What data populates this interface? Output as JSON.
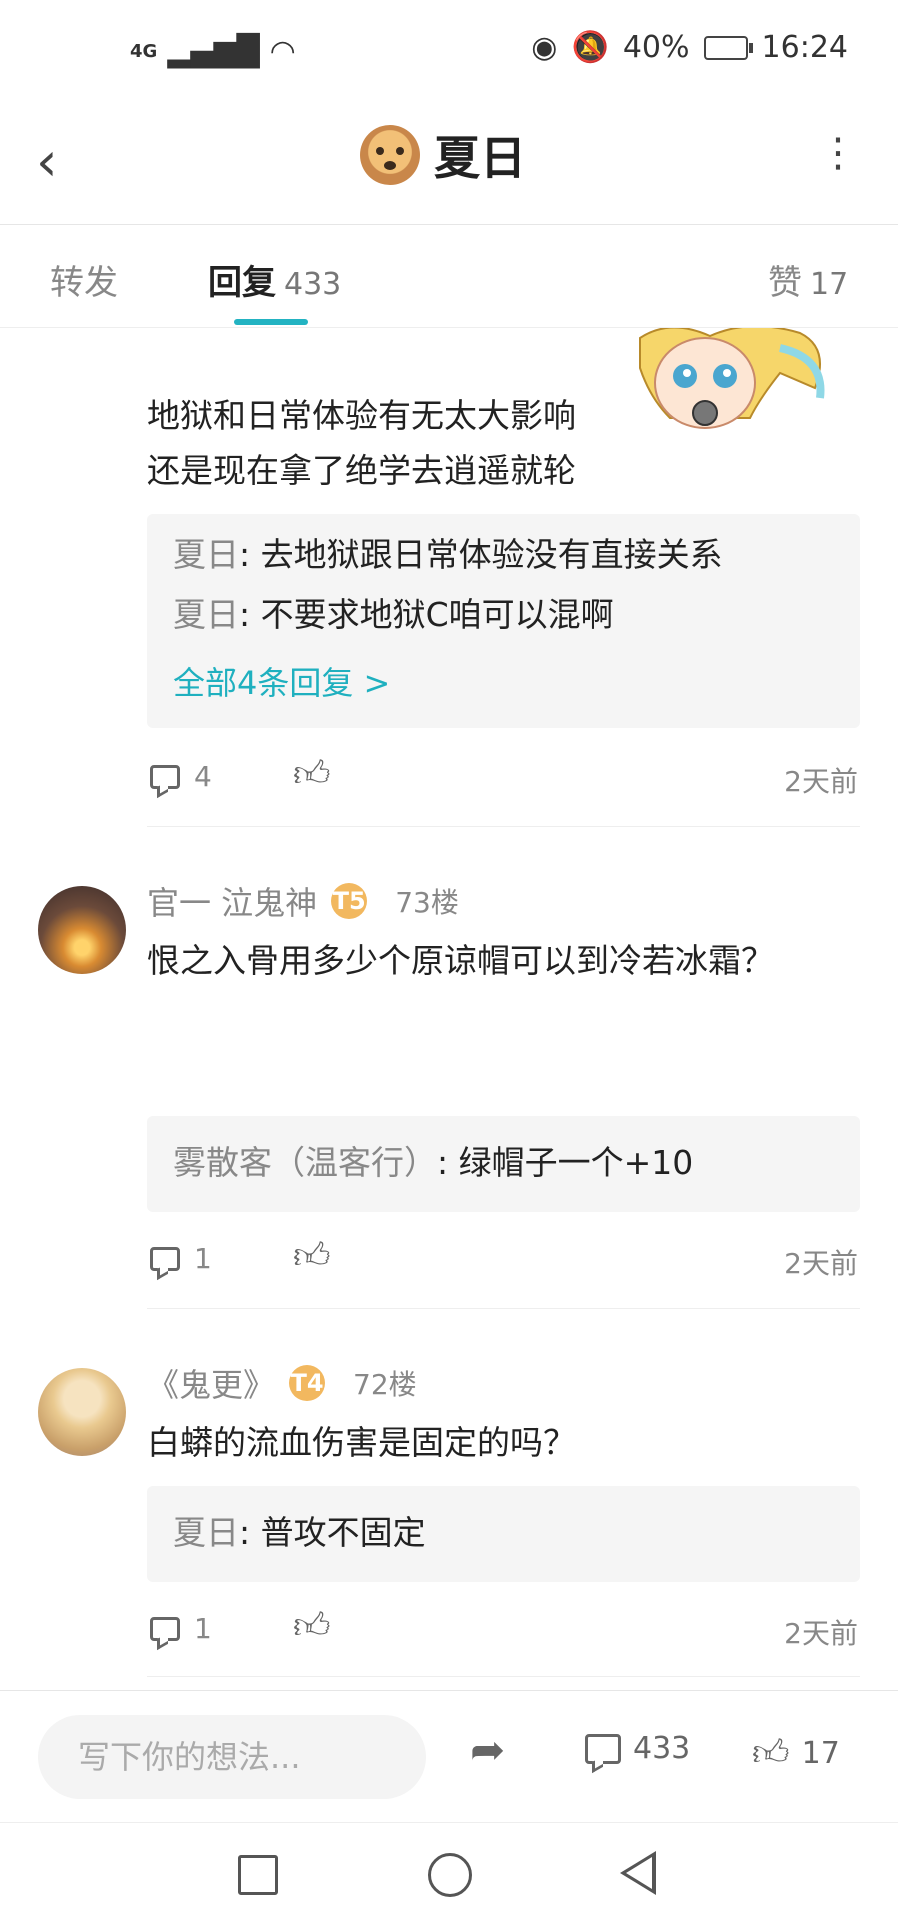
{
  "status_bar": {
    "network": "4G",
    "battery": "40%",
    "time": "16:24"
  },
  "header": {
    "title": "夏日"
  },
  "tabs": {
    "forward": "转发",
    "reply": "回复",
    "reply_count": "433",
    "like": "赞",
    "like_count": "17"
  },
  "comments": [
    {
      "text_lines": [
        "地狱和日常体验有无太大影响",
        "还是现在拿了绝学去逍遥就轮"
      ],
      "replies": [
        {
          "name": "夏日",
          "text": ": 去地狱跟日常体验没有直接关系"
        },
        {
          "name": "夏日",
          "text": ": 不要求地狱C咱可以混啊"
        }
      ],
      "more_replies": "全部4条回复 >",
      "comment_count": "4",
      "time": "2天前"
    },
    {
      "user": "官一  泣鬼神",
      "badge": "T5",
      "floor": "73楼",
      "text": "恨之入骨用多少个原谅帽可以到冷若冰霜？",
      "replies": [
        {
          "name": "雾散客（温客行）",
          "text": ": 绿帽子一个+10"
        }
      ],
      "comment_count": "1",
      "time": "2天前"
    },
    {
      "user": "《鬼更》",
      "badge": "T4",
      "floor": "72楼",
      "text": "白蟒的流血伤害是固定的吗？",
      "replies": [
        {
          "name": "夏日",
          "text": ": 普攻不固定"
        }
      ],
      "comment_count": "1",
      "time": "2天前"
    }
  ],
  "bottom_bar": {
    "placeholder": "写下你的想法...",
    "comment_count": "433",
    "like_count": "17"
  }
}
